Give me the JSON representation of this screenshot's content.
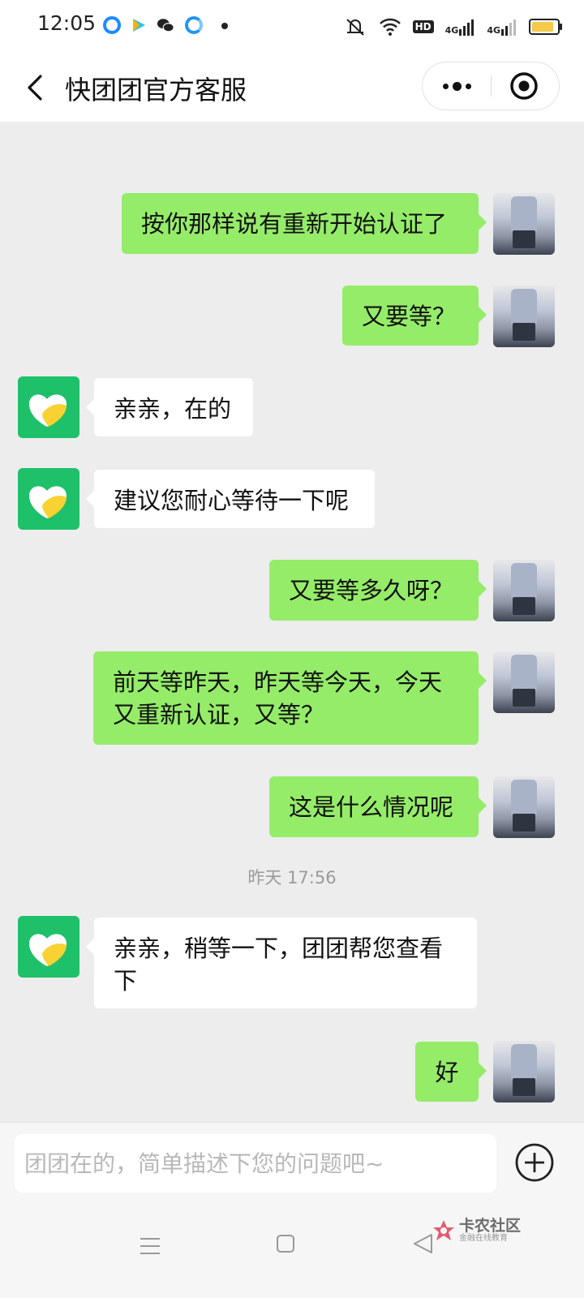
{
  "status_bar": {
    "time": "12:05",
    "notification_icons": [
      "qq-browser-icon",
      "tencent-video-icon",
      "wechat-icon",
      "browser-icon",
      "more-dot-icon"
    ],
    "status_icons": [
      "mute-icon",
      "wifi-icon",
      "hd-icon",
      "4g-signal-icon",
      "4g-signal-icon",
      "battery-icon"
    ],
    "hd_label": "HD",
    "net_label": "4G"
  },
  "header": {
    "title": "快团团官方客服",
    "back_icon": "chevron-left-icon",
    "more_icon": "more-dots-icon",
    "close_icon": "target-icon"
  },
  "messages": [
    {
      "sender": "me",
      "text": "按你那样说有重新开始认证了"
    },
    {
      "sender": "me",
      "text": "又要等？"
    },
    {
      "sender": "bot",
      "text": "亲亲，在的"
    },
    {
      "sender": "bot",
      "text": "建议您耐心等待一下呢"
    },
    {
      "sender": "me",
      "text": "又要等多久呀？"
    },
    {
      "sender": "me",
      "text": "前天等昨天，昨天等今天，今天又重新认证，又等？"
    },
    {
      "sender": "me",
      "text": "这是什么情况呢"
    },
    {
      "sender": "bot",
      "text": "亲亲，稍等一下，团团帮您查看下"
    },
    {
      "sender": "me",
      "text": "好"
    }
  ],
  "timestamp": "昨天 17:56",
  "input": {
    "placeholder": "团团在的，简单描述下您的问题吧~",
    "value": "",
    "plus_icon": "plus-circle-icon"
  },
  "nav_bar": {
    "menu_icon": "menu-icon",
    "home_icon": "home-square-icon",
    "back_icon": "back-triangle-icon"
  },
  "watermark": {
    "title": "卡农社区",
    "subtitle": "金融在线教育"
  },
  "colors": {
    "my_bubble": "#95ec69",
    "bot_bubble": "#ffffff",
    "background": "#ededed",
    "bot_avatar": "#1fc06a"
  }
}
